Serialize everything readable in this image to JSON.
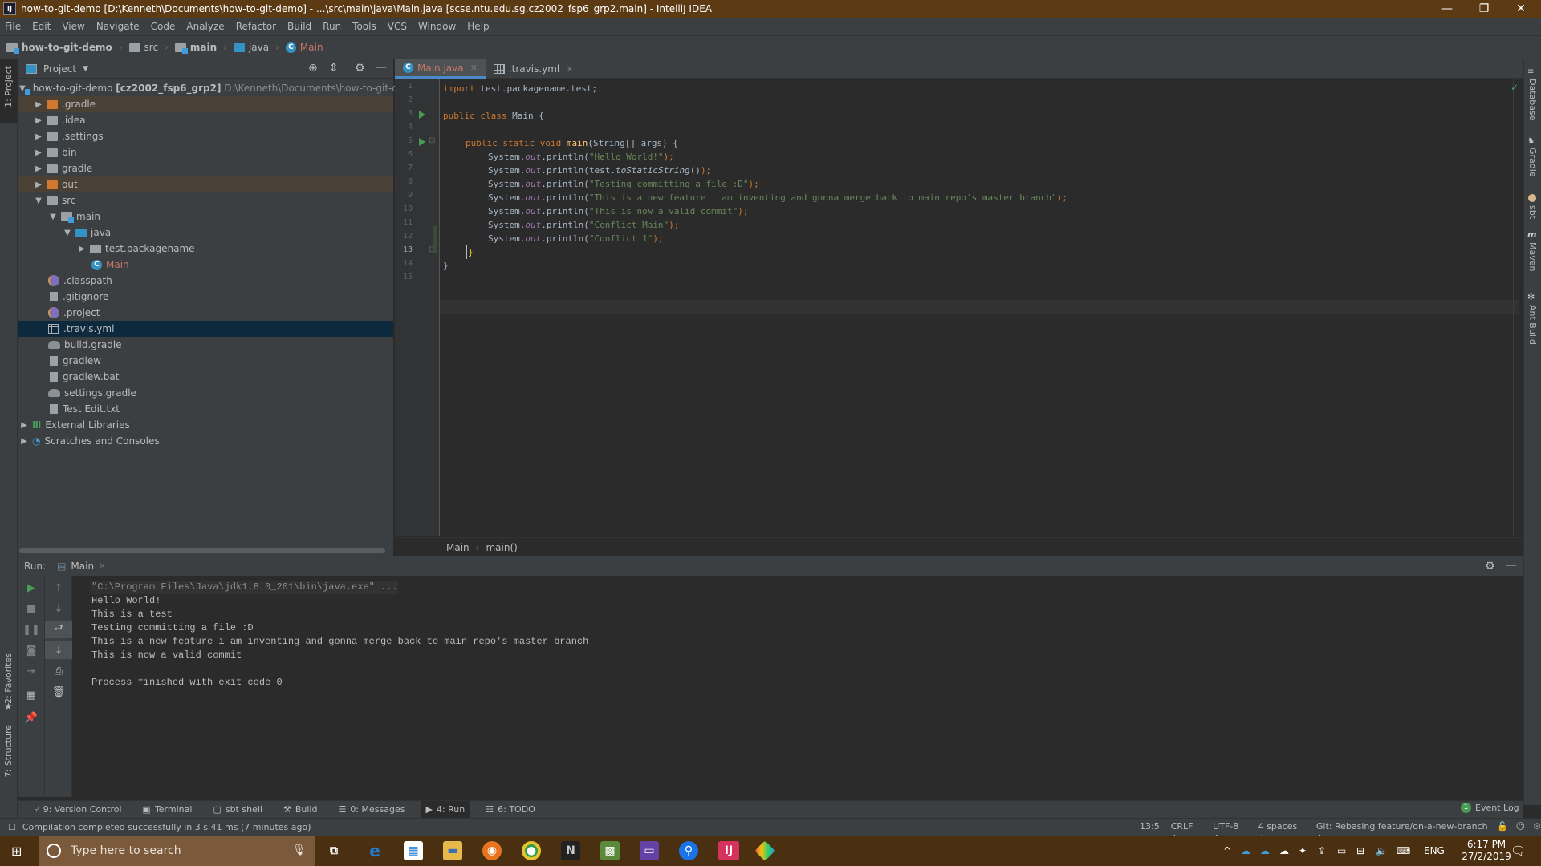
{
  "window": {
    "title": "how-to-git-demo [D:\\Kenneth\\Documents\\how-to-git-demo] - ...\\src\\main\\java\\Main.java [scse.ntu.edu.sg.cz2002_fsp6_grp2.main] - IntelliJ IDEA",
    "app_icon": "IJ",
    "controls": {
      "minimize": "—",
      "restore": "❐",
      "close": "✕"
    }
  },
  "menu": [
    "File",
    "Edit",
    "View",
    "Navigate",
    "Code",
    "Analyze",
    "Refactor",
    "Build",
    "Run",
    "Tools",
    "VCS",
    "Window",
    "Help"
  ],
  "navbar": {
    "breadcrumb": [
      "how-to-git-demo",
      "src",
      "main",
      "java",
      "Main"
    ],
    "run_config": "Main",
    "git_label": "Git:"
  },
  "left_strip": {
    "project": "1: Project",
    "favorites": "2: Favorites",
    "structure": "7: Structure"
  },
  "right_strip": [
    "Database",
    "Gradle",
    "sbt",
    "Maven",
    "Ant Build"
  ],
  "project_panel": {
    "title": "Project",
    "root": {
      "name": "how-to-git-demo",
      "module": "[cz2002_fsp6_grp2]",
      "path": "D:\\Kenneth\\Documents\\how-to-git-dem"
    },
    "items": [
      {
        "label": ".gradle",
        "type": "folder-excluded",
        "expanded": false
      },
      {
        "label": ".idea",
        "type": "folder",
        "expanded": false
      },
      {
        "label": ".settings",
        "type": "folder",
        "expanded": false
      },
      {
        "label": "bin",
        "type": "folder",
        "expanded": false
      },
      {
        "label": "gradle",
        "type": "folder",
        "expanded": false
      },
      {
        "label": "out",
        "type": "folder-excluded",
        "expanded": false
      },
      {
        "label": "src",
        "type": "folder",
        "expanded": true
      },
      {
        "label": "main",
        "type": "module-folder",
        "expanded": true
      },
      {
        "label": "java",
        "type": "source-folder",
        "expanded": true
      },
      {
        "label": "test.packagename",
        "type": "package",
        "expanded": false
      },
      {
        "label": "Main",
        "type": "java-class"
      },
      {
        "label": ".classpath",
        "type": "eclipse-file"
      },
      {
        "label": ".gitignore",
        "type": "text-file"
      },
      {
        "label": ".project",
        "type": "eclipse-file"
      },
      {
        "label": ".travis.yml",
        "type": "yaml-file",
        "selected": true
      },
      {
        "label": "build.gradle",
        "type": "gradle-file"
      },
      {
        "label": "gradlew",
        "type": "text-file"
      },
      {
        "label": "gradlew.bat",
        "type": "text-file"
      },
      {
        "label": "settings.gradle",
        "type": "gradle-file"
      },
      {
        "label": "Test Edit.txt",
        "type": "text-file"
      },
      {
        "label": "External Libraries",
        "type": "libraries",
        "expanded": false
      },
      {
        "label": "Scratches and Consoles",
        "type": "scratches",
        "expanded": false
      }
    ]
  },
  "editor": {
    "tabs": [
      {
        "label": "Main.java",
        "active": true
      },
      {
        "label": ".travis.yml",
        "active": false
      }
    ],
    "line_numbers": [
      "1",
      "2",
      "3",
      "4",
      "5",
      "6",
      "7",
      "8",
      "9",
      "10",
      "11",
      "12",
      "13",
      "14",
      "15"
    ],
    "lines": {
      "l1_kw": "import",
      "l1_rest": " test.packagename.test;",
      "l3_kw": "public class",
      "l3_rest": " Main {",
      "l5_kw": "public static void",
      "l5_fn": "main",
      "l5_rest": "(String[] args) {",
      "sys": "System.",
      "out": "out",
      "println": ".println(",
      "l6_str": "\"Hello World!\"",
      "l7_call": "test.",
      "l7_it": "toStaticString",
      "l7_end": "()",
      "l8_str": "\"Testing committing a file :D\"",
      "l9_str": "\"This is a new feature i am inventing and gonna merge back to main repo's master branch\"",
      "l10_str": "\"This is now a valid commit\"",
      "l11_str": "\"Conflict Main\"",
      "l12_str": "\"Conflict 1\"",
      "close_paren": ");",
      "l13": "}",
      "l14": "}"
    },
    "breadcrumb": [
      "Main",
      "main()"
    ]
  },
  "run_panel": {
    "label": "Run:",
    "tab": "Main",
    "console": [
      "\"C:\\Program Files\\Java\\jdk1.8.0_201\\bin\\java.exe\" ...",
      "Hello World!",
      "This is a test",
      "Testing committing a file :D",
      "This is a new feature i am inventing and gonna merge back to main repo's master branch",
      "This is now a valid commit",
      "",
      "Process finished with exit code 0"
    ]
  },
  "tool_windows": [
    {
      "label": "9: Version Control",
      "icon": "vcs-icon"
    },
    {
      "label": "Terminal",
      "icon": "terminal-icon"
    },
    {
      "label": "sbt shell",
      "icon": "sbt-icon"
    },
    {
      "label": "Build",
      "icon": "hammer-icon"
    },
    {
      "label": "0: Messages",
      "icon": "messages-icon"
    },
    {
      "label": "4: Run",
      "icon": "run-icon",
      "active": true
    },
    {
      "label": "6: TODO",
      "icon": "todo-icon"
    }
  ],
  "event_log": {
    "label": "Event Log",
    "count": "1"
  },
  "status": {
    "message": "Compilation completed successfully in 3 s 41 ms (7 minutes ago)",
    "position": "13:5",
    "line_sep": "CRLF ÷",
    "encoding": "UTF-8 ÷",
    "indent": "4 spaces ÷",
    "git": "Git: Rebasing feature/on-a-new-branch ÷"
  },
  "taskbar": {
    "search_placeholder": "Type here to search",
    "lang": "ENG",
    "time": "6:17 PM",
    "date": "27/2/2019"
  },
  "colors": {
    "accent": "#4a88c7",
    "run_green": "#499c54",
    "titlebar": "#5c3a14"
  }
}
